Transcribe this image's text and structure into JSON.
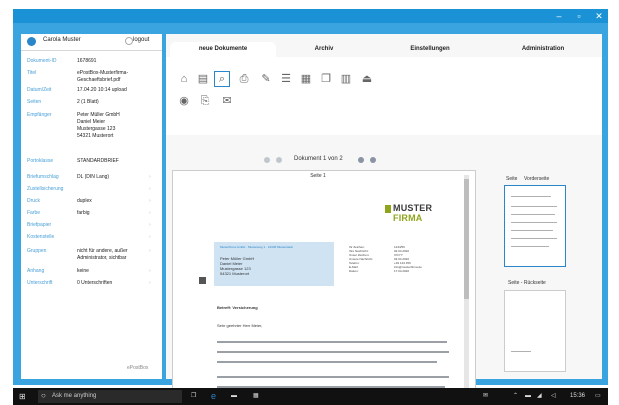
{
  "window": {
    "controls": [
      "–",
      "▫",
      "✕"
    ],
    "accent": "#1b92d6"
  },
  "user": {
    "name": "Carola Muster",
    "logout": "logout"
  },
  "fields": [
    {
      "label": "Dokument-ID",
      "value": "1678691",
      "arrow": ""
    },
    {
      "label": "Titel",
      "value": "ePostBox-Musterfirma-\nGeschaeftsbrief.pdf",
      "arrow": ""
    },
    {
      "label": "Datum/Zeit",
      "value": "17.04.20 10:14 upload",
      "arrow": ""
    },
    {
      "label": "Seiten",
      "value": "2 (1 Blatt)",
      "arrow": ""
    },
    {
      "label": "Empfänger",
      "value": "Peter Müller GmbH\nDaniel Meier\nMustergasse 123\n54321 Musterort",
      "arrow": ""
    },
    {
      "label": "Portoklasse",
      "value": "STANDARDBRIEF",
      "arrow": ""
    },
    {
      "label": "Briefumschlag",
      "value": "DL (DIN Lang)",
      "arrow": "›"
    },
    {
      "label": "Zustellsicherung",
      "value": "",
      "arrow": "›"
    },
    {
      "label": "Druck",
      "value": "duplex",
      "arrow": "›"
    },
    {
      "label": "Farbe",
      "value": "farbig",
      "arrow": "›"
    },
    {
      "label": "Briefpapier",
      "value": "",
      "arrow": "›"
    },
    {
      "label": "Kostenstelle",
      "value": "",
      "arrow": "›"
    },
    {
      "label": "Gruppen",
      "value": "nicht für andere, außer\nAdministrator, sichtbar",
      "arrow": "›"
    },
    {
      "label": "Anhang",
      "value": "keine",
      "arrow": "›"
    },
    {
      "label": "Unterschrift",
      "value": "0 Unterschriften",
      "arrow": "›"
    }
  ],
  "brand_footer": "ePostBox",
  "tabs": [
    {
      "label": "neue Dokumente",
      "active": true
    },
    {
      "label": "Archiv",
      "active": false
    },
    {
      "label": "Einstellungen",
      "active": false
    },
    {
      "label": "Administration",
      "active": false
    }
  ],
  "toolbar_icons": [
    {
      "name": "archive-icon",
      "glyph": "⌂"
    },
    {
      "name": "document-icon",
      "glyph": "▤"
    },
    {
      "name": "document-search-icon",
      "glyph": "⌕"
    },
    {
      "name": "print-icon",
      "glyph": "⎙"
    },
    {
      "name": "document-edit-icon",
      "glyph": "✎"
    },
    {
      "name": "document-list-icon",
      "glyph": "☰"
    },
    {
      "name": "clipboard-icon",
      "glyph": "▦"
    },
    {
      "name": "document-copy-icon",
      "glyph": "❐"
    },
    {
      "name": "book-icon",
      "glyph": "▥"
    },
    {
      "name": "eject-icon",
      "glyph": "⏏"
    },
    {
      "name": "stamp-icon",
      "glyph": "◉"
    },
    {
      "name": "printer-send-icon",
      "glyph": "⎘"
    },
    {
      "name": "mail-stack-icon",
      "glyph": "✉"
    }
  ],
  "pager": {
    "text": "Dokument 1 von 2"
  },
  "viewer": {
    "page_label": "Seite 1",
    "logo_text_a": "MUSTER",
    "logo_text_b": " FIRMA",
    "sender_line": "Musterfirma GmbH · Musterweg 1 · 12345 Musterstadt",
    "recipient": [
      "Peter Müller GmbH",
      "Daniel Meier",
      "Mustergasse 123",
      "54321 Musterort"
    ],
    "info_block": "Ihr Zeichen:\nIhre Nachricht:\nUnser Zeichen:\nUnsere Nachricht:\nTelefon:\nE-Mail:\nDatum:",
    "info_values": "1234/56\n02.04.2020\nXX/YY\n03.04.2020\n+49 123 456\ninfo@musterfirma.de\n17.04.2020",
    "subject": "Betreff: Versicherung",
    "salutation": "Sehr geehrter Herr Meier,"
  },
  "preview": {
    "page_label": "Seite",
    "front_label": "Vorderseite",
    "back_label": "Seite - Rückseite"
  },
  "taskbar": {
    "search_placeholder": "Ask me anything",
    "clock": "15:36"
  }
}
